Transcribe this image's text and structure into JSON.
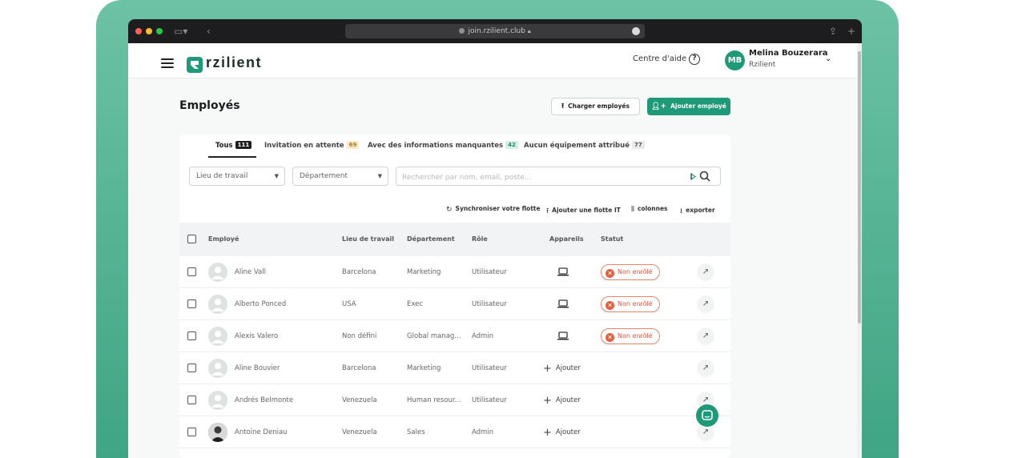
{
  "browser": {
    "url": "join.rzilient.club"
  },
  "colors": {
    "brand": "#1f9a78",
    "status_error": "#e0603f",
    "frame": "#4fb38f"
  },
  "nav": {
    "brand": "rzilient",
    "help_label": "Centre d'aide",
    "user_initials": "MB",
    "user_name": "Melina Bouzerara",
    "user_org": "Rzilient"
  },
  "page": {
    "title": "Employés",
    "upload_button": "Charger employés",
    "add_button": "Ajouter employé"
  },
  "tabs": [
    {
      "label": "Tous",
      "count": "111"
    },
    {
      "label": "Invitation en attente",
      "count": "69"
    },
    {
      "label": "Avec des informations manquantes",
      "count": "42"
    },
    {
      "label": "Aucun équipement attribué",
      "count": "77"
    }
  ],
  "filters": {
    "location_label": "Lieu de travail",
    "department_label": "Département",
    "search_placeholder": "Rechercher par nom, email, poste..."
  },
  "actions": {
    "sync": "Synchroniser votre flotte",
    "add_fleet": "Ajouter une flotte IT",
    "columns": "colonnes",
    "export": "exporter"
  },
  "table": {
    "headers": {
      "employee": "Employé",
      "location": "Lieu de travail",
      "department": "Département",
      "role": "Rôle",
      "devices": "Appareils",
      "status": "Statut"
    },
    "add_device_label": "Ajouter",
    "rows": [
      {
        "name": "Aline Vall",
        "location": "Barcelona",
        "department": "Marketing",
        "role": "Utilisateur",
        "device": "laptop",
        "status": "Non enrôlé"
      },
      {
        "name": "Alberto Ponced",
        "location": "USA",
        "department": "Exec",
        "role": "Utilisateur",
        "device": "laptop",
        "status": "Non enrôlé"
      },
      {
        "name": "Alexis Valero",
        "location": "Non défini",
        "department": "Global manag...",
        "role": "Admin",
        "device": "laptop",
        "status": "Non enrôlé"
      },
      {
        "name": "Aline Bouvier",
        "location": "Barcelona",
        "department": "Marketing",
        "role": "Utilisateur",
        "device": "add",
        "status": ""
      },
      {
        "name": "Andrés Belmonte",
        "location": "Venezuela",
        "department": "Human resour...",
        "role": "Utilisateur",
        "device": "add",
        "status": ""
      },
      {
        "name": "Antoine Deniau",
        "location": "Venezuela",
        "department": "Sales",
        "role": "Admin",
        "device": "add",
        "status": ""
      }
    ]
  }
}
